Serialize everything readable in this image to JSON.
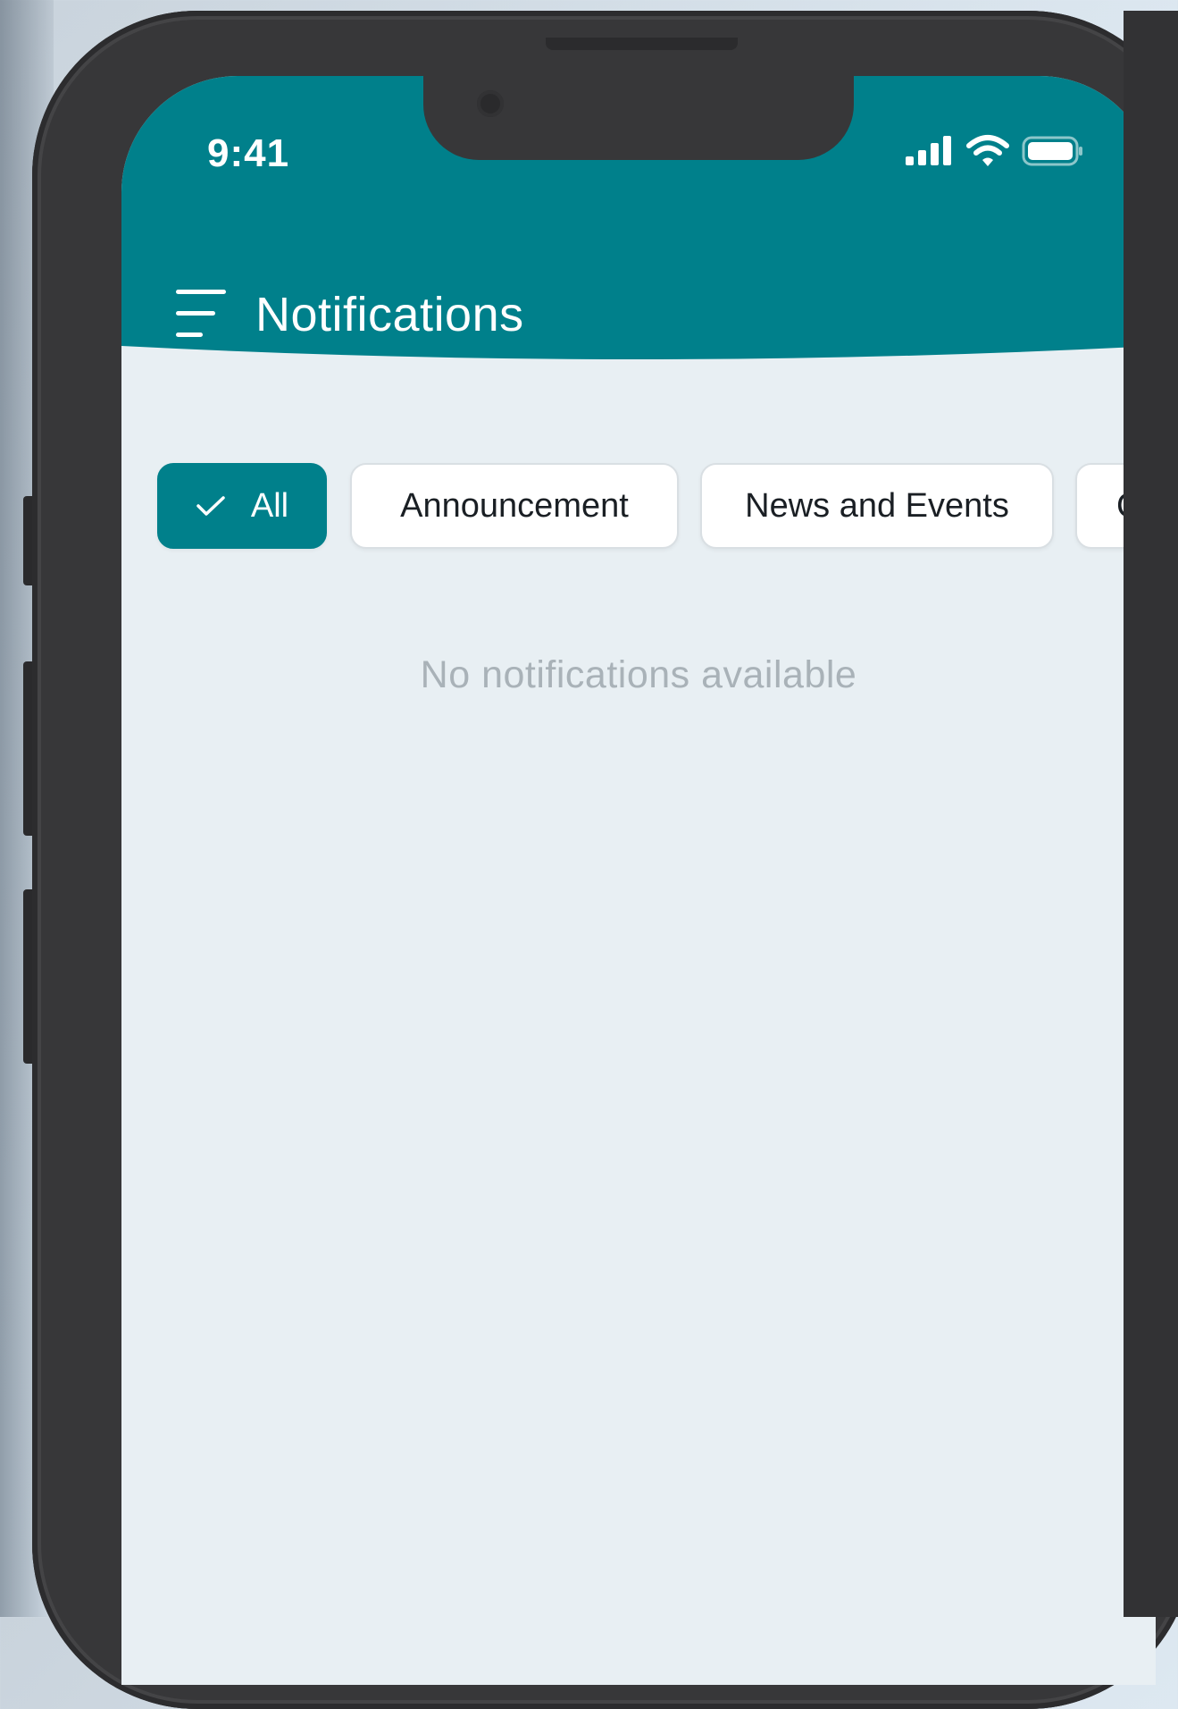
{
  "status_bar": {
    "time": "9:41"
  },
  "header": {
    "title": "Notifications",
    "background_color": "#00808b"
  },
  "filter_chips": [
    {
      "label": "All",
      "selected": true
    },
    {
      "label": "Announcement",
      "selected": false
    },
    {
      "label": "News and Events",
      "selected": false
    },
    {
      "label": "Co",
      "selected": false
    }
  ],
  "empty_state": {
    "message": "No notifications available"
  },
  "icons": {
    "menu": "menu-icon",
    "check": "check-icon",
    "signal": "signal-icon",
    "wifi": "wifi-icon",
    "battery": "battery-icon"
  },
  "colors": {
    "accent": "#00808b",
    "screen_background": "#e8eff3",
    "chip_background": "#ffffff",
    "muted_text": "#a9b2b8"
  }
}
